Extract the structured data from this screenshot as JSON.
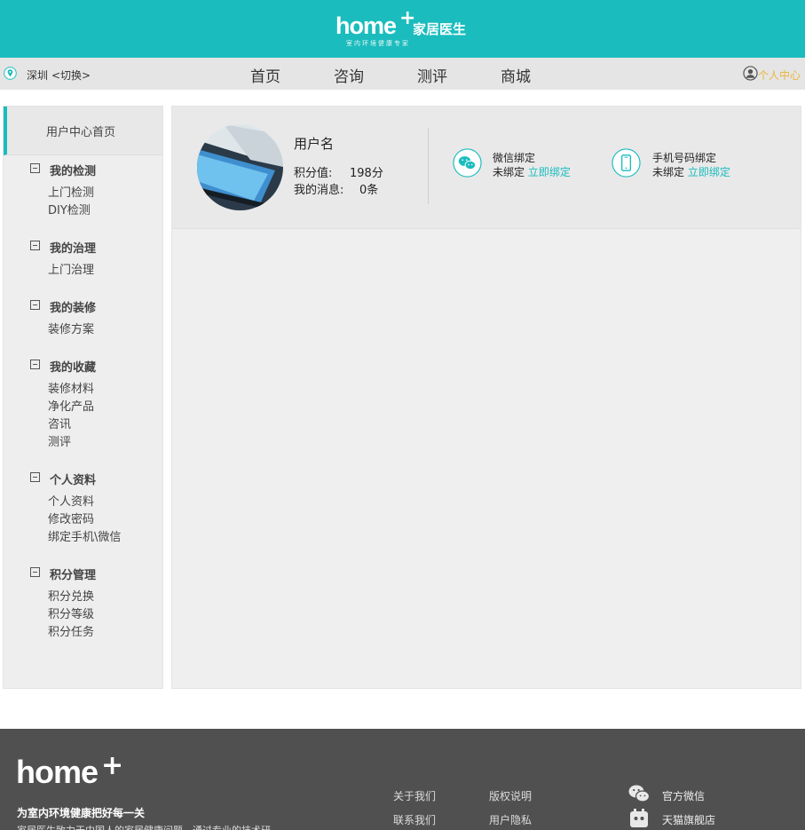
{
  "header": {
    "logo_home": "home",
    "logo_plus": "+",
    "logo_cn": "家居医生",
    "logo_slogan": "室内环境健康专家",
    "brand_color": "#1bbcbd"
  },
  "navbar": {
    "city": "深圳",
    "switch_label": "<切换>",
    "items": [
      "首页",
      "咨询",
      "测评",
      "商城"
    ],
    "user_center": "个人中心"
  },
  "sidebar": {
    "home_label": "用户中心首页",
    "groups": [
      {
        "title": "我的检测",
        "items": [
          "上门检测",
          "DIY检测"
        ]
      },
      {
        "title": "我的治理",
        "items": [
          "上门治理"
        ]
      },
      {
        "title": "我的装修",
        "items": [
          "装修方案"
        ]
      },
      {
        "title": "我的收藏",
        "items": [
          "装修材料",
          "净化产品",
          "咨讯",
          "测评"
        ]
      },
      {
        "title": "个人资料",
        "items": [
          "个人资料",
          "修改密码",
          "绑定手机\\微信"
        ]
      },
      {
        "title": "积分管理",
        "items": [
          "积分兑换",
          "积分等级",
          "积分任务"
        ]
      }
    ]
  },
  "profile": {
    "username": "用户名",
    "points_label": "积分值:",
    "points_value": "198分",
    "messages_label": "我的消息:",
    "messages_value": "0条",
    "wechat": {
      "title": "微信绑定",
      "status": "未绑定",
      "action": "立即绑定",
      "icon": "wechat-icon"
    },
    "phone": {
      "title": "手机号码绑定",
      "status": "未绑定",
      "action": "立即绑定",
      "icon": "mobile-phone-icon"
    }
  },
  "footer": {
    "logo_home": "home",
    "logo_plus": "+",
    "tagline": "为室内环境健康把好每一关",
    "description": "家居医生致力于中国人的家居健康问题，通过专业的技术研",
    "links": [
      "关于我们",
      "版权说明",
      "联系我们",
      "用户隐私"
    ],
    "social": [
      {
        "label": "官方微信",
        "icon": "wechat-icon"
      },
      {
        "label": "天猫旗舰店",
        "icon": "tmall-icon"
      }
    ]
  }
}
